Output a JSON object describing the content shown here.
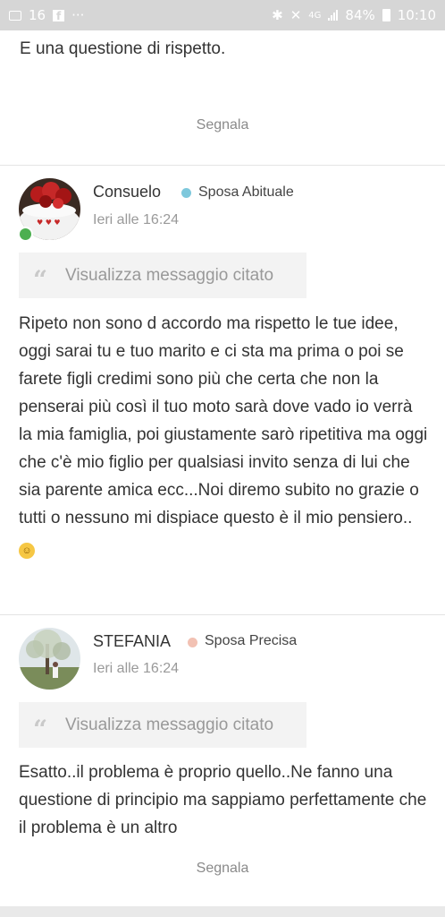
{
  "status_bar": {
    "notification_count": "16",
    "network": "4G",
    "battery": "84%",
    "time": "10:10"
  },
  "previous_post": {
    "text_tail": "E una questione di rispetto.",
    "report_label": "Segnala"
  },
  "posts": [
    {
      "username": "Consuelo",
      "rank": "Sposa Abituale",
      "rank_color": "#7ec8dc",
      "online": true,
      "time": "Ieri alle 16:24",
      "quote_label": "Visualizza messaggio citato",
      "message": "Ripeto non sono d accordo ma rispetto le tue idee, oggi sarai tu e tuo marito e ci sta ma prima o poi se farete figli credimi sono più che certa che non la penserai più così il tuo moto sarà dove vado io verrà la mia famiglia, poi giustamente sarò ripetitiva ma oggi che c'è mio figlio per qualsiasi invito senza di lui che sia parente amica ecc...Noi diremo subito no grazie o tutti o nessuno mi dispiace questo è il mio pensiero.."
    },
    {
      "username": "STEFANIA",
      "rank": "Sposa Precisa",
      "rank_color": "#f2c1b3",
      "online": false,
      "time": "Ieri alle 16:24",
      "quote_label": "Visualizza messaggio citato",
      "message": "Esatto..il problema è proprio quello..Ne fanno una questione di principio ma sappiamo perfettamente che il problema è un altro",
      "report_label": "Segnala"
    }
  ],
  "icons": {
    "emoji": "smiling-face-emoji-icon",
    "quote": "quote-icon"
  }
}
